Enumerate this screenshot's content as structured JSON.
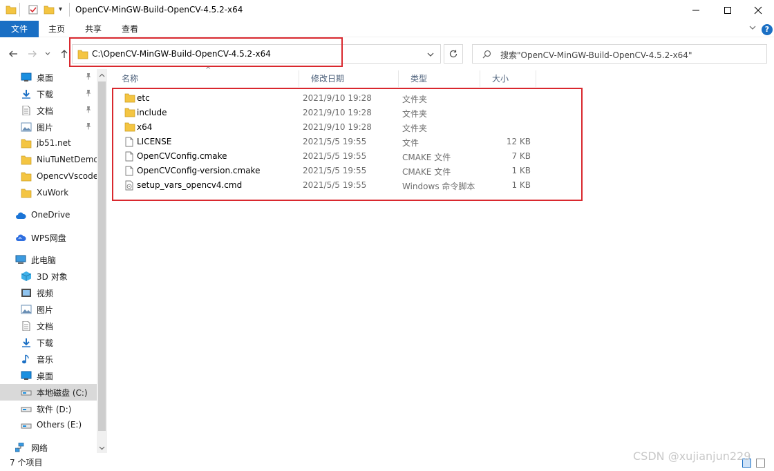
{
  "window": {
    "title": "OpenCV-MinGW-Build-OpenCV-4.5.2-x64",
    "minimize": "—",
    "maximize": "☐",
    "close": "✕"
  },
  "ribbon": {
    "tabs": [
      {
        "label": "文件"
      },
      {
        "label": "主页"
      },
      {
        "label": "共享"
      },
      {
        "label": "查看"
      }
    ],
    "expand": "⌄",
    "help": "?"
  },
  "nav": {
    "back": "←",
    "forward": "→",
    "recent": "⌄",
    "up": "↑",
    "address": "C:\\OpenCV-MinGW-Build-OpenCV-4.5.2-x64",
    "address_dropdown": "⌄",
    "refresh": "↻",
    "search_placeholder": "搜索\"OpenCV-MinGW-Build-OpenCV-4.5.2-x64\""
  },
  "sidebar": {
    "items": [
      {
        "label": "桌面",
        "icon": "desktop-icon",
        "pinned": true
      },
      {
        "label": "下载",
        "icon": "download-icon",
        "pinned": true
      },
      {
        "label": "文档",
        "icon": "document-icon",
        "pinned": true
      },
      {
        "label": "图片",
        "icon": "picture-icon",
        "pinned": true
      },
      {
        "label": "jb51.net",
        "icon": "folder-icon",
        "pinned": false
      },
      {
        "label": "NiuTuNetDemo",
        "icon": "folder-icon",
        "pinned": false
      },
      {
        "label": "OpencvVscode",
        "icon": "folder-icon",
        "pinned": false
      },
      {
        "label": "XuWork",
        "icon": "folder-icon",
        "pinned": false
      },
      {
        "label": "OneDrive",
        "icon": "cloud-icon",
        "pinned": false
      },
      {
        "label": "WPS网盘",
        "icon": "wps-cloud-icon",
        "pinned": false
      },
      {
        "label": "此电脑",
        "icon": "computer-icon",
        "pinned": false
      },
      {
        "label": "3D 对象",
        "icon": "cube-icon",
        "pinned": false
      },
      {
        "label": "视频",
        "icon": "video-icon",
        "pinned": false
      },
      {
        "label": "图片",
        "icon": "picture-icon",
        "pinned": false
      },
      {
        "label": "文档",
        "icon": "document-icon",
        "pinned": false
      },
      {
        "label": "下载",
        "icon": "download-icon",
        "pinned": false
      },
      {
        "label": "音乐",
        "icon": "music-icon",
        "pinned": false
      },
      {
        "label": "桌面",
        "icon": "desktop-icon",
        "pinned": false
      },
      {
        "label": "本地磁盘 (C:)",
        "icon": "drive-icon",
        "pinned": false,
        "selected": true
      },
      {
        "label": "软件 (D:)",
        "icon": "drive-icon",
        "pinned": false
      },
      {
        "label": "Others (E:)",
        "icon": "drive-icon",
        "pinned": false
      },
      {
        "label": "网络",
        "icon": "network-icon",
        "pinned": false
      }
    ],
    "pin_glyph": "📌"
  },
  "columns": {
    "name": "名称",
    "date": "修改日期",
    "type": "类型",
    "size": "大小",
    "sort_indicator": "^"
  },
  "files": [
    {
      "name": "etc",
      "date": "2021/9/10 19:28",
      "type": "文件夹",
      "size": "",
      "icon": "folder-icon"
    },
    {
      "name": "include",
      "date": "2021/9/10 19:28",
      "type": "文件夹",
      "size": "",
      "icon": "folder-icon"
    },
    {
      "name": "x64",
      "date": "2021/9/10 19:28",
      "type": "文件夹",
      "size": "",
      "icon": "folder-icon"
    },
    {
      "name": "LICENSE",
      "date": "2021/5/5 19:55",
      "type": "文件",
      "size": "12 KB",
      "icon": "file-icon"
    },
    {
      "name": "OpenCVConfig.cmake",
      "date": "2021/5/5 19:55",
      "type": "CMAKE 文件",
      "size": "7 KB",
      "icon": "file-icon"
    },
    {
      "name": "OpenCVConfig-version.cmake",
      "date": "2021/5/5 19:55",
      "type": "CMAKE 文件",
      "size": "1 KB",
      "icon": "file-icon"
    },
    {
      "name": "setup_vars_opencv4.cmd",
      "date": "2021/5/5 19:55",
      "type": "Windows 命令脚本",
      "size": "1 KB",
      "icon": "cmd-script-icon"
    }
  ],
  "status": {
    "count": "7 个项目"
  },
  "watermark": "CSDN @xujianjun229",
  "colors": {
    "accent": "#1a6fc4",
    "highlight_box": "#d9282e",
    "folder": "#f4c542"
  }
}
